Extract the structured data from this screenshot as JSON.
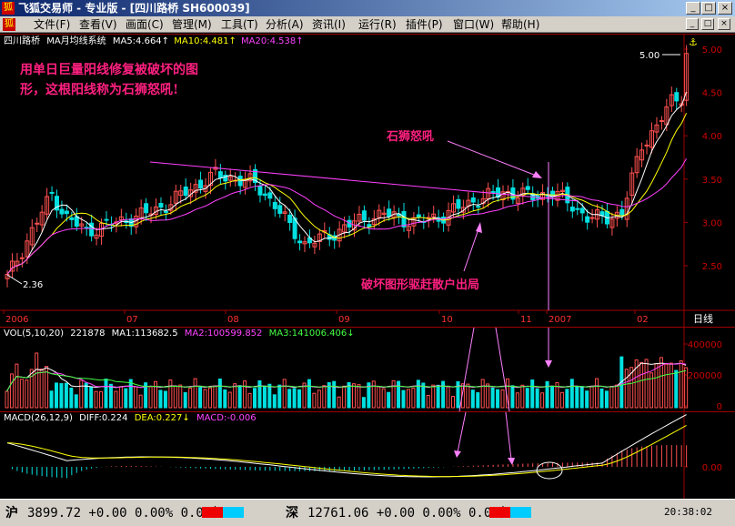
{
  "window": {
    "title": "飞狐交易师 - 专业版 - [四川路桥 SH600039]",
    "minimize_glyph": "_",
    "maximize_glyph": "□",
    "close_glyph": "×"
  },
  "menu": {
    "items": [
      "文件(F)",
      "查看(V)",
      "画面(C)",
      "管理(M)",
      "工具(T)",
      "分析(A)",
      "资讯(I)",
      "运行(R)",
      "插件(P)",
      "窗口(W)",
      "帮助(H)"
    ]
  },
  "price_panel": {
    "stock_name": "四川路桥",
    "indicator": "MA月均线系统",
    "ma5": "MA5:4.664",
    "ma10": "MA10:4.481",
    "ma20": "MA20:4.538",
    "up_arrow": "↑",
    "y_ticks": [
      "5.00",
      "4.50",
      "4.00",
      "3.50",
      "3.00",
      "2.50"
    ],
    "high_label": "5.00",
    "low_label": "2.36",
    "x_labels": [
      "2006",
      "07",
      "08",
      "09",
      "10",
      "11",
      "2007",
      "02"
    ],
    "period_label": "日线",
    "annotation_top": [
      "用单日巨量阳线修复被破坏的图",
      "形，这根阳线称为石狮怒吼!"
    ],
    "annotation_lion": "石狮怒吼",
    "annotation_broken": "破坏图形驱赶散户出局",
    "colors": {
      "up": "#ff5050",
      "down": "#00e0e0",
      "ma5": "#ffffff",
      "ma10": "#ffff00",
      "ma20": "#ff40ff",
      "annotation": "#ff2080"
    }
  },
  "volume_panel": {
    "label": "VOL(5,10,20)",
    "value": "221878",
    "ma1": "MA1:113682.5",
    "ma2": "MA2:100599.852",
    "ma3": "MA3:141006.406",
    "down_arrow": "↓",
    "y_ticks": [
      "400000",
      "200000",
      "0"
    ]
  },
  "macd_panel": {
    "label": "MACD(26,12,9)",
    "diff": "DIFF:0.224",
    "dea": "DEA:0.227",
    "macd": "MACD:-0.006",
    "y_ticks": [
      "0.00"
    ]
  },
  "status_bar": {
    "sh_label": "沪",
    "sh_value": "3899.72 +0.00 0.00% 0.00亿",
    "sz_label": "深",
    "sz_value": "12761.06 +0.00 0.00% 0.00亿",
    "time": "20:38:02"
  }
}
